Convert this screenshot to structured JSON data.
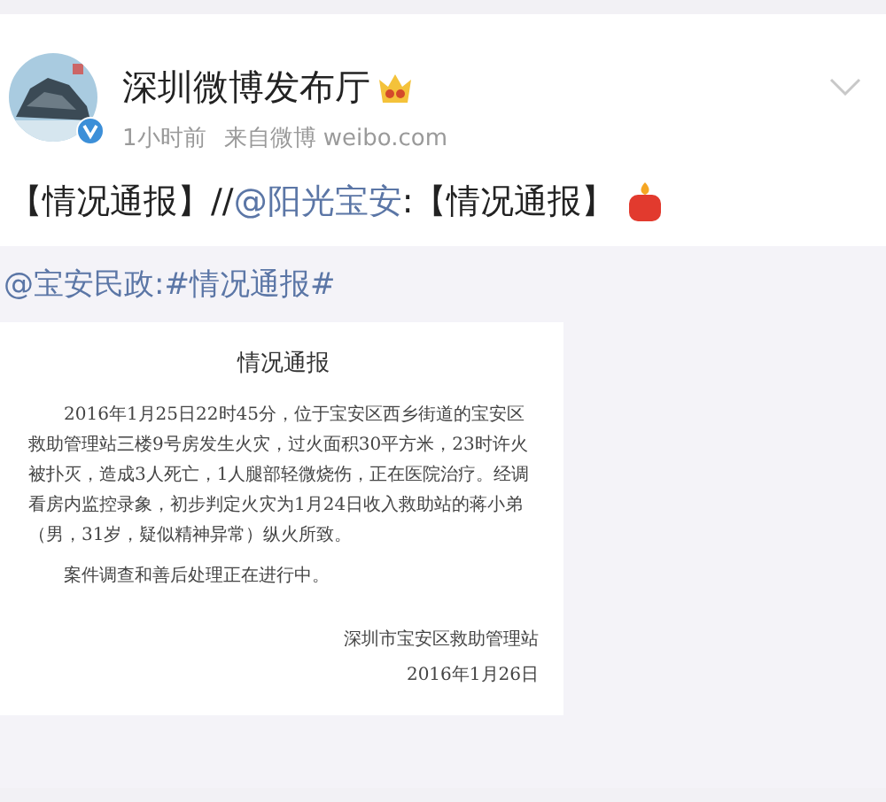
{
  "post": {
    "author": "深圳微博发布厅",
    "time": "1小时前",
    "source": "来自微博 weibo.com",
    "text": [
      {
        "kind": "text",
        "text": "【情况通报】//"
      },
      {
        "kind": "mention",
        "text": "@阳光宝安"
      },
      {
        "kind": "text",
        "text": ":【情况通报】"
      }
    ]
  },
  "repost": {
    "text": "@宝安民政:#情况通报#",
    "document": {
      "title": "情况通报",
      "paragraphs": [
        "2016年1月25日22时45分，位于宝安区西乡街道的宝安区救助管理站三楼9号房发生火灾，过火面积30平方米，23时许火被扑灭，造成3人死亡，1人腿部轻微烧伤，正在医院治疗。经调看房内监控录象，初步判定火灾为1月24日收入救助站的蒋小弟（男，31岁，疑似精神异常）纵火所致。",
        "案件调查和善后处理正在进行中。"
      ],
      "signature": "深圳市宝安区救助管理站",
      "date": "2016年1月26日"
    }
  }
}
